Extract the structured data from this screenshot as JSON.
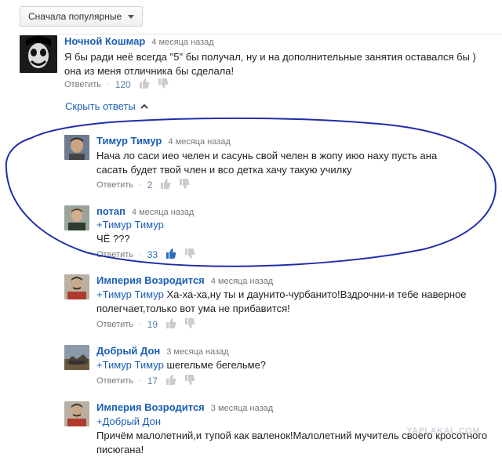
{
  "sort": {
    "label": "Сначала популярные"
  },
  "main_comment": {
    "author": "Ночной Кошмар",
    "time": "4 месяца назад",
    "text": "Я бы ради неё всегда \"5\" бы получал, ну и на дополнительные занятия оставался бы ) она из меня отличника бы сделала!",
    "reply_label": "Ответить",
    "likes": "120"
  },
  "hide_replies_label": "Скрыть ответы",
  "replies": [
    {
      "author": "Тимур Тимур",
      "time": "4 месяца назад",
      "mention": "",
      "text": "Нача ло саси иео челен и сасунь свой челен в жопу июо наху пусть ана сасать будет твой  член и всо детка хачу такую училку",
      "reply_label": "Ответить",
      "likes": "2"
    },
    {
      "author": "потап",
      "time": "4 месяца назад",
      "mention": "+Тимур Тимур",
      "text": "ЧЁ ???",
      "reply_label": "Ответить",
      "likes": "33"
    },
    {
      "author": "Империя Возродится",
      "time": "4 месяца назад",
      "mention": "+Тимур Тимур",
      "text": "Ха-ха-ха,ну ты и даунито-чурбанито!Вздрочни-и тебе наверное полегчает,только вот ума не прибавится!",
      "reply_label": "Ответить",
      "likes": "19"
    },
    {
      "author": "Добрый Дон",
      "time": "3 месяца назад",
      "mention": "+Тимур Тимур",
      "text": "шегельме бегельме?",
      "reply_label": "Ответить",
      "likes": "17"
    },
    {
      "author": "Империя Возродится",
      "time": "3 месяца назад",
      "mention": "+Добрый Дон",
      "text": "Причём малолетний,и тупой как валенок!Малолетний мучитель своего кросотного писюгана!",
      "reply_label": "",
      "likes": ""
    }
  ],
  "watermark": "YAPLAKAL.COM",
  "colors": {
    "link": "#1a5fb4",
    "highlight_circle": "#1f2ea8",
    "liked": "#2a6ebb"
  }
}
